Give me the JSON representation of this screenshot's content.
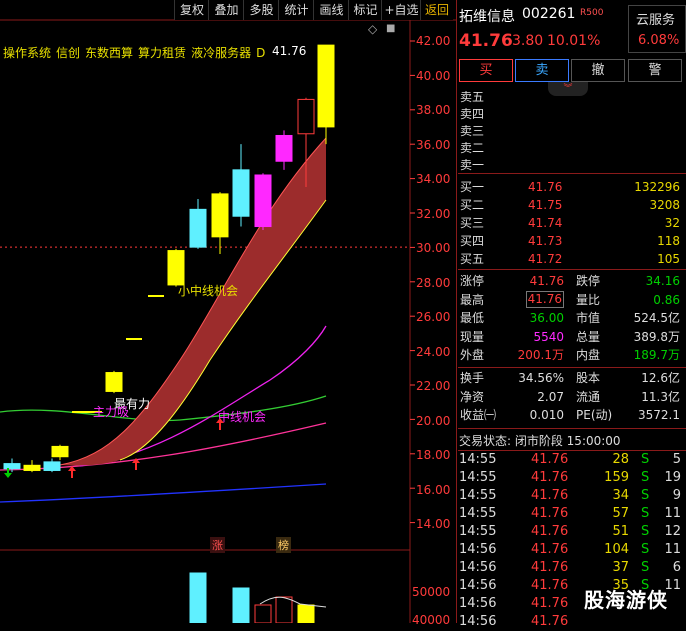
{
  "toolbar": [
    "复权",
    "叠加",
    "多股",
    "统计",
    "画线",
    "标记",
    "+自选",
    "返回"
  ],
  "indicators": [
    "操作系统",
    "信创",
    "东数西算",
    "算力租赁",
    "液冷服务器",
    "D"
  ],
  "last_price_label": "41.76",
  "y_axis": [
    "42.00",
    "40.00",
    "38.00",
    "36.00",
    "34.00",
    "32.00",
    "30.00",
    "28.00",
    "26.00",
    "24.00",
    "22.00",
    "20.00",
    "18.00",
    "16.00",
    "14.00"
  ],
  "vol_axis": [
    "50000",
    "40000"
  ],
  "annotations": {
    "a1": "小中线机会",
    "a2": "最有力",
    "a3": "主力吸",
    "a4": "中线机会",
    "tag_zhang": "涨",
    "tag_bang": "榜"
  },
  "stock": {
    "name": "拓维信息",
    "code": "002261",
    "badge": "R500",
    "sector_name": "云服务",
    "sector_pct": "6.08%",
    "price": "41.76",
    "change": "3.80",
    "pct": "10.01%"
  },
  "actions": [
    "买",
    "卖",
    "撤",
    "警"
  ],
  "asks": [
    {
      "label": "卖五",
      "price": "",
      "vol": ""
    },
    {
      "label": "卖四",
      "price": "",
      "vol": ""
    },
    {
      "label": "卖三",
      "price": "",
      "vol": ""
    },
    {
      "label": "卖二",
      "price": "",
      "vol": ""
    },
    {
      "label": "卖一",
      "price": "",
      "vol": ""
    }
  ],
  "bids": [
    {
      "label": "买一",
      "price": "41.76",
      "vol": "132296"
    },
    {
      "label": "买二",
      "price": "41.75",
      "vol": "3208"
    },
    {
      "label": "买三",
      "price": "41.74",
      "vol": "32"
    },
    {
      "label": "买四",
      "price": "41.73",
      "vol": "118"
    },
    {
      "label": "买五",
      "price": "41.72",
      "vol": "105"
    }
  ],
  "stats1": [
    {
      "l1": "涨停",
      "v1": "41.76",
      "l2": "跌停",
      "v2": "34.16"
    },
    {
      "l1": "最高",
      "v1": "41.76",
      "l2": "量比",
      "v2": "0.86"
    },
    {
      "l1": "最低",
      "v1": "36.00",
      "l2": "市值",
      "v2": "524.5亿"
    },
    {
      "l1": "现量",
      "v1": "5540",
      "l2": "总量",
      "v2": "389.8万"
    },
    {
      "l1": "外盘",
      "v1": "200.1万",
      "l2": "内盘",
      "v2": "189.7万"
    }
  ],
  "stats2": [
    {
      "l1": "换手",
      "v1": "34.56%",
      "l2": "股本",
      "v2": "12.6亿"
    },
    {
      "l1": "净资",
      "v1": "2.07",
      "l2": "流通",
      "v2": "11.3亿"
    },
    {
      "l1": "收益㈠",
      "v1": "0.010",
      "l2": "PE(动)",
      "v2": "3572.1"
    }
  ],
  "trade_status": "交易状态: 闭市阶段 15:00:00",
  "ticks": [
    {
      "t": "14:55",
      "p": "41.76",
      "v": "28",
      "s": "S",
      "n": "5"
    },
    {
      "t": "14:55",
      "p": "41.76",
      "v": "159",
      "s": "S",
      "n": "19"
    },
    {
      "t": "14:55",
      "p": "41.76",
      "v": "34",
      "s": "S",
      "n": "9"
    },
    {
      "t": "14:55",
      "p": "41.76",
      "v": "57",
      "s": "S",
      "n": "11"
    },
    {
      "t": "14:55",
      "p": "41.76",
      "v": "51",
      "s": "S",
      "n": "12"
    },
    {
      "t": "14:56",
      "p": "41.76",
      "v": "104",
      "s": "S",
      "n": "11"
    },
    {
      "t": "14:56",
      "p": "41.76",
      "v": "37",
      "s": "S",
      "n": "6"
    },
    {
      "t": "14:56",
      "p": "41.76",
      "v": "35",
      "s": "S",
      "n": "11"
    },
    {
      "t": "14:56",
      "p": "41.76",
      "v": "",
      "s": "",
      "n": ""
    },
    {
      "t": "14:56",
      "p": "41.76",
      "v": "",
      "s": "",
      "n": ""
    }
  ],
  "watermark": "股海游侠",
  "colors": {
    "up": "#ff3b3b",
    "down": "#00d000",
    "candle_cyan": "#5ff0ff",
    "candle_yellow": "#ffff00",
    "candle_magenta": "#ff28ff",
    "band": "#9c2c2c"
  }
}
